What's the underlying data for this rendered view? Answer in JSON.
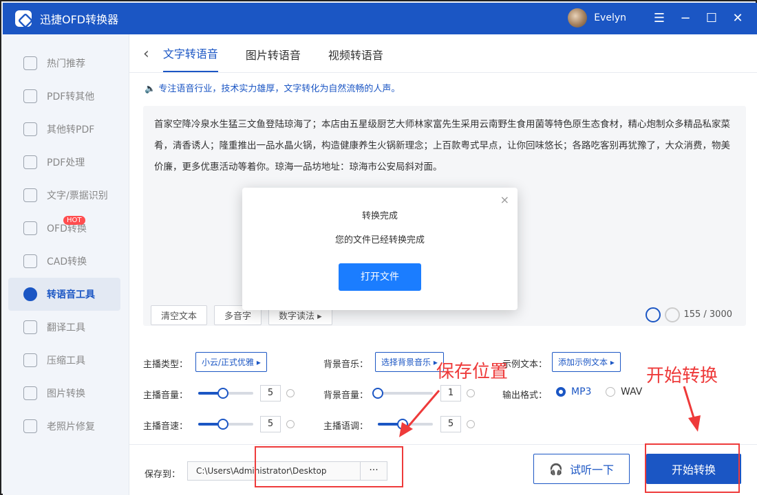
{
  "app": {
    "title": "迅捷OFD转换器",
    "username": "Evelyn"
  },
  "window_controls": {
    "menu": "☰",
    "minimize": "−",
    "maximize": "☐",
    "close": "✕"
  },
  "sidebar": {
    "items": [
      {
        "label": "热门推荐",
        "icon": "hot-icon"
      },
      {
        "label": "PDF转其他",
        "icon": "pdf-icon"
      },
      {
        "label": "其他转PDF",
        "icon": "file-icon"
      },
      {
        "label": "PDF处理",
        "icon": "pdf-process-icon"
      },
      {
        "label": "文字/票据识别",
        "icon": "ocr-icon"
      },
      {
        "label": "OFD转换",
        "icon": "ofd-icon",
        "badge": "HOT"
      },
      {
        "label": "CAD转换",
        "icon": "cad-icon"
      },
      {
        "label": "转语音工具",
        "icon": "voice-icon",
        "active": true
      },
      {
        "label": "翻译工具",
        "icon": "translate-icon"
      },
      {
        "label": "压缩工具",
        "icon": "compress-icon"
      },
      {
        "label": "图片转换",
        "icon": "image-icon"
      },
      {
        "label": "老照片修复",
        "icon": "photo-icon"
      }
    ]
  },
  "tabs": {
    "back": "‹",
    "items": [
      "文字转语音",
      "图片转语音",
      "视频转语音"
    ]
  },
  "hint": "专注语音行业，技术实力雄厚，文字转化为自然流畅的人声。",
  "editor": {
    "text": "首家空降冷泉水生猛三文鱼登陆琼海了；本店由五星级厨艺大师林家富先生采用云南野生食用菌等特色原生态食材，精心炮制众多精品私家菜肴，清香诱人；隆重推出一品水晶火锅，构造健康养生火锅新理念；上百款粤式早点，让你回味悠长；各路吃客别再犹豫了，大众消费，物美价廉，更多优惠活动等着你。琼海一品坊地址：琼海市公安局斜对面。",
    "tools": [
      "清空文本",
      "多音字",
      "数字读法 ▸"
    ],
    "counter": "155 / 3000"
  },
  "settings": {
    "anchor_type_label": "主播类型：",
    "anchor_type_value": "小云/正式优雅 ▸",
    "bgm_label": "背景音乐：",
    "bgm_value": "选择背景音乐 ▸",
    "example_label": "示例文本：",
    "example_value": "添加示例文本 ▸",
    "anchor_volume_label": "主播音量：",
    "anchor_volume": "5",
    "anchor_volume_level": 0.45,
    "bgm_volume_label": "背景音量：",
    "bgm_volume": "1",
    "bgm_volume_level": 0.0,
    "format_label": "输出格式：",
    "format_mp3": "MP3",
    "format_wav": "WAV",
    "anchor_speed_label": "主播音速：",
    "anchor_speed": "5",
    "anchor_speed_level": 0.45,
    "anchor_pitch_label": "主播语调：",
    "anchor_pitch": "5",
    "anchor_pitch_level": 0.45
  },
  "bottom": {
    "save_label": "保存到：",
    "path": "C:\\Users\\Administrator\\Desktop",
    "more": "···",
    "listen": "试听一下",
    "start": "开始转换"
  },
  "modal": {
    "title": "转换完成",
    "message": "您的文件已经转换完成",
    "button": "打开文件",
    "close": "×"
  },
  "annotations": {
    "save_location": "保存位置",
    "start_convert": "开始转换",
    "color": "#ee3a3a"
  }
}
